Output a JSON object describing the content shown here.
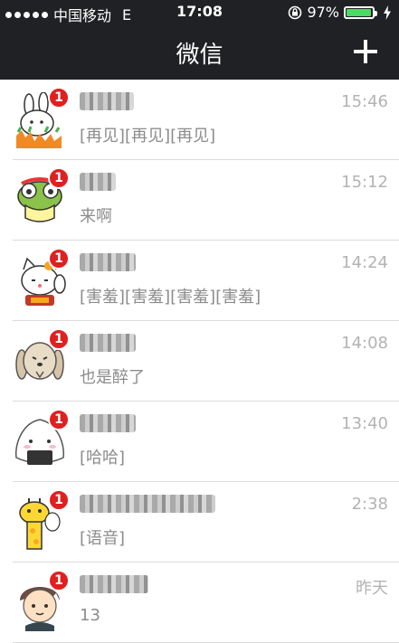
{
  "status_bar": {
    "carrier": "中国移动",
    "network": "E",
    "time": "17:08",
    "battery_percent": "97%",
    "battery_level": 0.97,
    "icons": [
      "signal-dots-icon",
      "rotation-lock-icon",
      "battery-icon",
      "charging-icon"
    ]
  },
  "nav": {
    "title": "微信",
    "add_icon": "plus-icon"
  },
  "colors": {
    "bar_bg": "#1f2124",
    "badge": "#e02020",
    "time_text": "#b3b3b3",
    "message_text": "#8c8c8c",
    "battery_fill": "#4cd964"
  },
  "chats": [
    {
      "avatar": "bunny-sticker-avatar",
      "badge": "1",
      "time": "15:46",
      "message": "[再见][再见][再见]"
    },
    {
      "avatar": "frog-sticker-avatar",
      "badge": "1",
      "time": "15:12",
      "message": "来啊"
    },
    {
      "avatar": "lucky-cat-sticker-avatar",
      "badge": "1",
      "time": "14:24",
      "message": "[害羞][害羞][害羞][害羞]"
    },
    {
      "avatar": "dog-sticker-avatar",
      "badge": "1",
      "time": "14:08",
      "message": "也是醉了"
    },
    {
      "avatar": "rice-ball-sticker-avatar",
      "badge": "1",
      "time": "13:40",
      "message": "[哈哈]"
    },
    {
      "avatar": "giraffe-sticker-avatar",
      "badge": "1",
      "time": "2:38",
      "message": "[语音]"
    },
    {
      "avatar": "cartoon-boy-avatar",
      "badge": "1",
      "time": "昨天",
      "message": "13"
    }
  ]
}
